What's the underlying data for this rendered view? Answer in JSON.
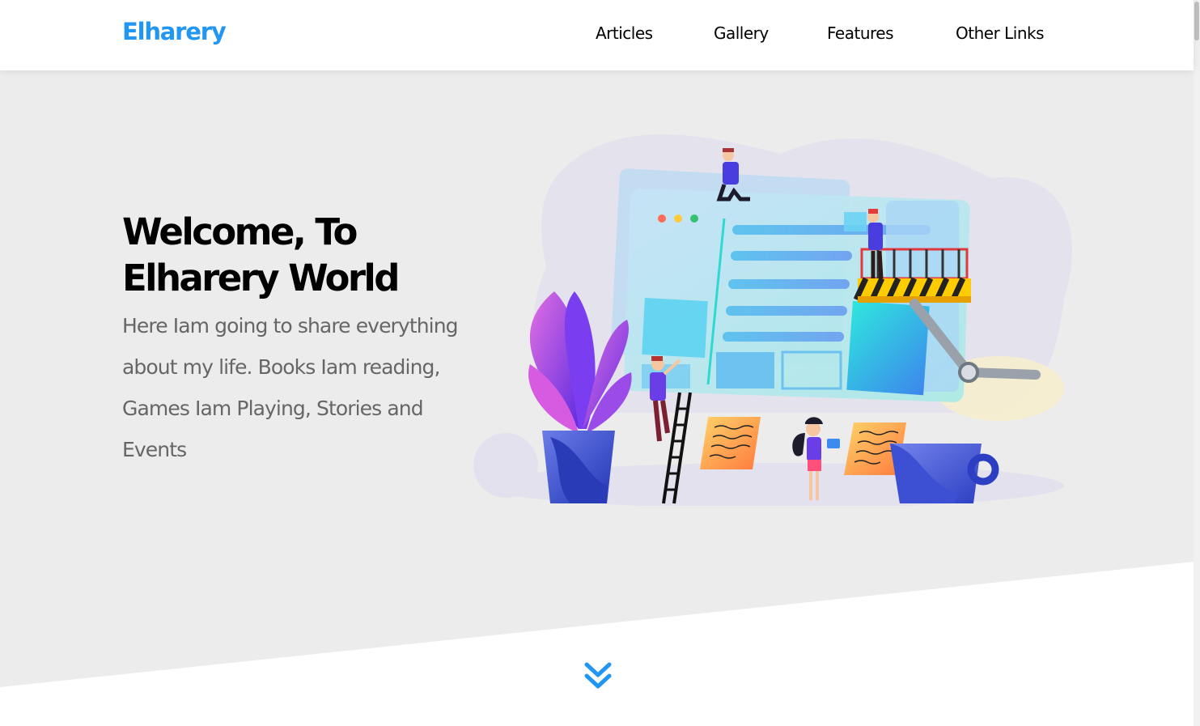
{
  "header": {
    "logo": "Elharery",
    "nav": [
      "Articles",
      "Gallery",
      "Features",
      "Other Links"
    ]
  },
  "hero": {
    "title": "Welcome, To Elharery World",
    "text": "Here Iam going to share everything about my life. Books Iam reading, Games Iam Playing, Stories and Events"
  },
  "icons": {
    "scroll_down": "double-chevron-down-icon",
    "illustration": "website-under-construction-illustration"
  },
  "colors": {
    "brand": "#2196f3",
    "hero_background": "#ececec",
    "body_text": "#666666",
    "heading": "#000000"
  }
}
